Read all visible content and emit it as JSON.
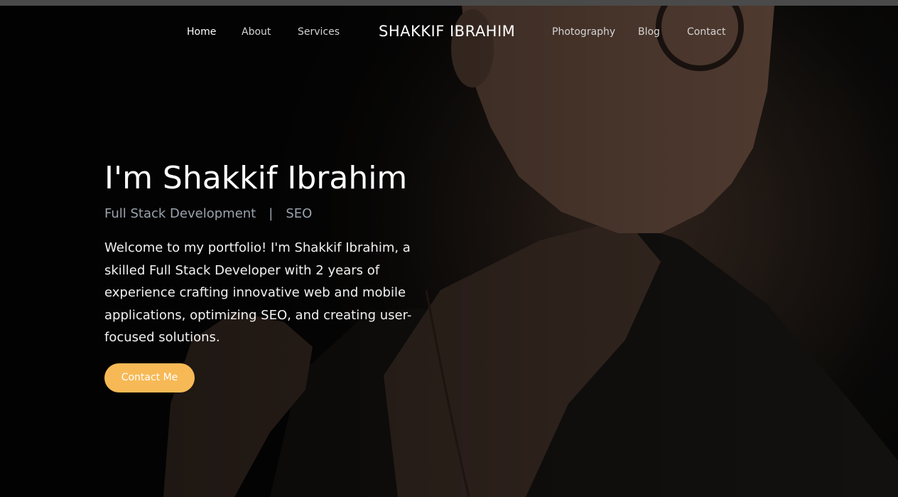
{
  "nav": {
    "home": "Home",
    "about": "About",
    "services": "Services",
    "brand": "SHAKKIF IBRAHIM",
    "photography": "Photography",
    "blog": "Blog",
    "contact": "Contact"
  },
  "hero": {
    "title": "I'm Shakkif Ibrahim",
    "role_1": "Full Stack Development",
    "separator": "|",
    "role_2": "SEO",
    "bio": "Welcome to my portfolio! I'm Shakkif Ibrahim, a skilled Full Stack Developer with 2 years of experience crafting innovative web and mobile applications, optimizing SEO, and creating user-focused solutions.",
    "cta_label": "Contact Me"
  },
  "colors": {
    "accent": "#f7b955",
    "roles_text": "#9aa3ad",
    "background": "#000000"
  }
}
